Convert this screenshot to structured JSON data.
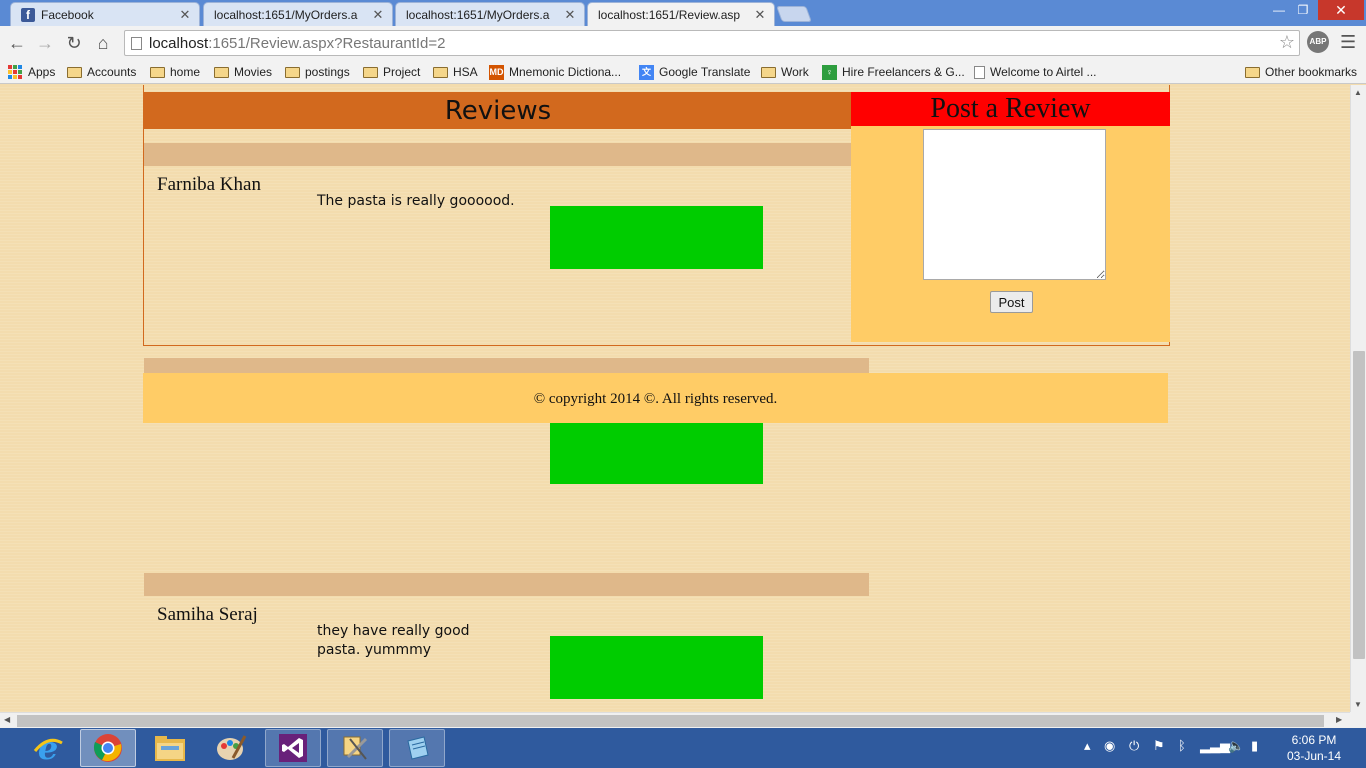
{
  "browser": {
    "tabs": [
      {
        "title": "Facebook",
        "favicon": "facebook-icon",
        "active": false
      },
      {
        "title": "localhost:1651/MyOrders.a",
        "favicon": "page-icon",
        "active": false
      },
      {
        "title": "localhost:1651/MyOrders.a",
        "favicon": "page-icon",
        "active": false
      },
      {
        "title": "localhost:1651/Review.asp",
        "favicon": "page-icon",
        "active": true
      }
    ],
    "url_host": "localhost",
    "url_path": ":1651/Review.aspx?RestaurantId=2",
    "extension_label": "ABP",
    "bookmarks": [
      {
        "label": "Apps",
        "icon": "apps-icon"
      },
      {
        "label": "Accounts",
        "icon": "folder-icon"
      },
      {
        "label": "home",
        "icon": "folder-icon"
      },
      {
        "label": "Movies",
        "icon": "folder-icon"
      },
      {
        "label": "postings",
        "icon": "folder-icon"
      },
      {
        "label": "Project",
        "icon": "folder-icon"
      },
      {
        "label": "HSA",
        "icon": "folder-icon"
      },
      {
        "label": "Mnemonic Dictiona...",
        "icon": "md-icon"
      },
      {
        "label": "Google Translate",
        "icon": "translate-icon"
      },
      {
        "label": "Work",
        "icon": "folder-icon"
      },
      {
        "label": "Hire Freelancers & G...",
        "icon": "freelancer-icon"
      },
      {
        "label": "Welcome to Airtel ...",
        "icon": "page-icon"
      }
    ],
    "other_bookmarks": "Other bookmarks"
  },
  "page": {
    "reviews_heading": "Reviews",
    "post_heading": "Post a Review",
    "post_button": "Post",
    "post_textarea_value": "",
    "reviews": [
      {
        "name": "Farniba Khan",
        "text": "The pasta is really goooood."
      },
      {
        "name": "",
        "text": ""
      },
      {
        "name": "Samiha Seraj",
        "text": "they have really good pasta. yummmy"
      }
    ],
    "footer": "© copyright 2014 ©. All rights reserved."
  },
  "taskbar": {
    "apps": [
      "internet-explorer-icon",
      "chrome-icon",
      "file-explorer-icon",
      "paint-icon",
      "visual-studio-icon",
      "tools-icon",
      "notepad-icon"
    ],
    "time": "6:06 PM",
    "date": "03-Jun-14"
  },
  "colors": {
    "page_bg": "#f3dcae",
    "reviews_header": "#d2691e",
    "post_header": "#ff0000",
    "post_panel": "#ffcc66",
    "review_bar": "#dfb88a",
    "rating_box": "#00cc00"
  }
}
